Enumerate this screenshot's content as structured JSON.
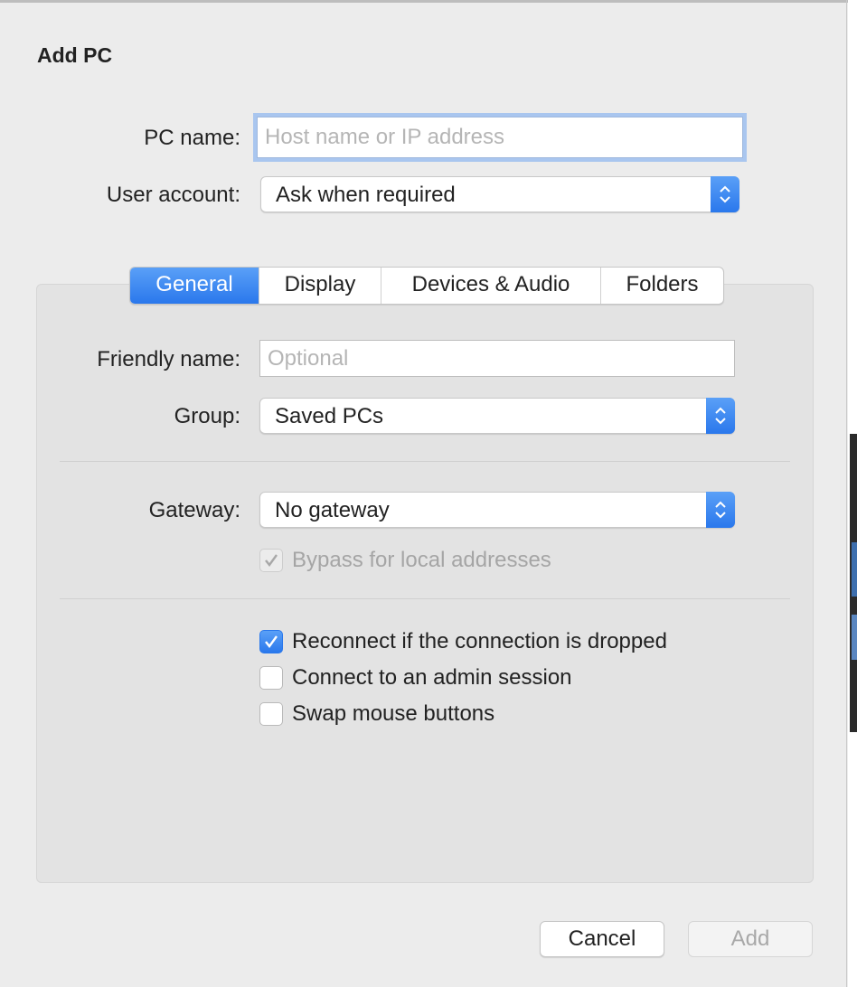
{
  "dialog": {
    "title": "Add PC"
  },
  "pc_name": {
    "label": "PC name:",
    "value": "",
    "placeholder": "Host name or IP address"
  },
  "user_account": {
    "label": "User account:",
    "selected": "Ask when required"
  },
  "tabs": [
    {
      "label": "General",
      "active": true
    },
    {
      "label": "Display",
      "active": false
    },
    {
      "label": "Devices & Audio",
      "active": false
    },
    {
      "label": "Folders",
      "active": false
    }
  ],
  "general": {
    "friendly_name": {
      "label": "Friendly name:",
      "value": "",
      "placeholder": "Optional"
    },
    "group": {
      "label": "Group:",
      "selected": "Saved PCs"
    },
    "gateway": {
      "label": "Gateway:",
      "selected": "No gateway"
    },
    "bypass_local": {
      "label": "Bypass for local addresses",
      "checked": true,
      "enabled": false
    },
    "options": [
      {
        "label": "Reconnect if the connection is dropped",
        "checked": true
      },
      {
        "label": "Connect to an admin session",
        "checked": false
      },
      {
        "label": "Swap mouse buttons",
        "checked": false
      }
    ]
  },
  "buttons": {
    "cancel": "Cancel",
    "add": "Add"
  },
  "colors": {
    "accent": "#2a78ec",
    "panel": "#e3e3e3",
    "window": "#ececec"
  }
}
